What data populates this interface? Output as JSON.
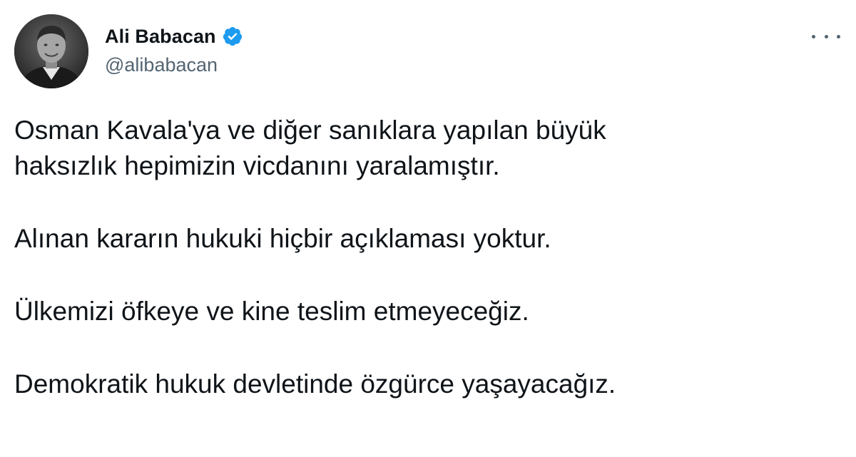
{
  "author": {
    "display_name": "Ali Babacan",
    "handle": "@alibabacan",
    "verified_icon": "verified-badge-icon",
    "avatar_icon": "profile-photo"
  },
  "menu": {
    "icon": "more-options-icon"
  },
  "tweet": {
    "paragraphs": [
      [
        "Osman Kavala'ya ve diğer sanıklara yapılan büyük",
        "haksızlık hepimizin vicdanını yaralamıştır."
      ],
      [
        "Alınan kararın hukuki hiçbir açıklaması yoktur."
      ],
      [
        "Ülkemizi öfkeye ve kine teslim etmeyeceğiz."
      ],
      [
        "Demokratik hukuk devletinde özgürce yaşayacağız."
      ]
    ]
  },
  "colors": {
    "text": "#0f1419",
    "secondary": "#536471",
    "verified": "#1d9bf0"
  }
}
